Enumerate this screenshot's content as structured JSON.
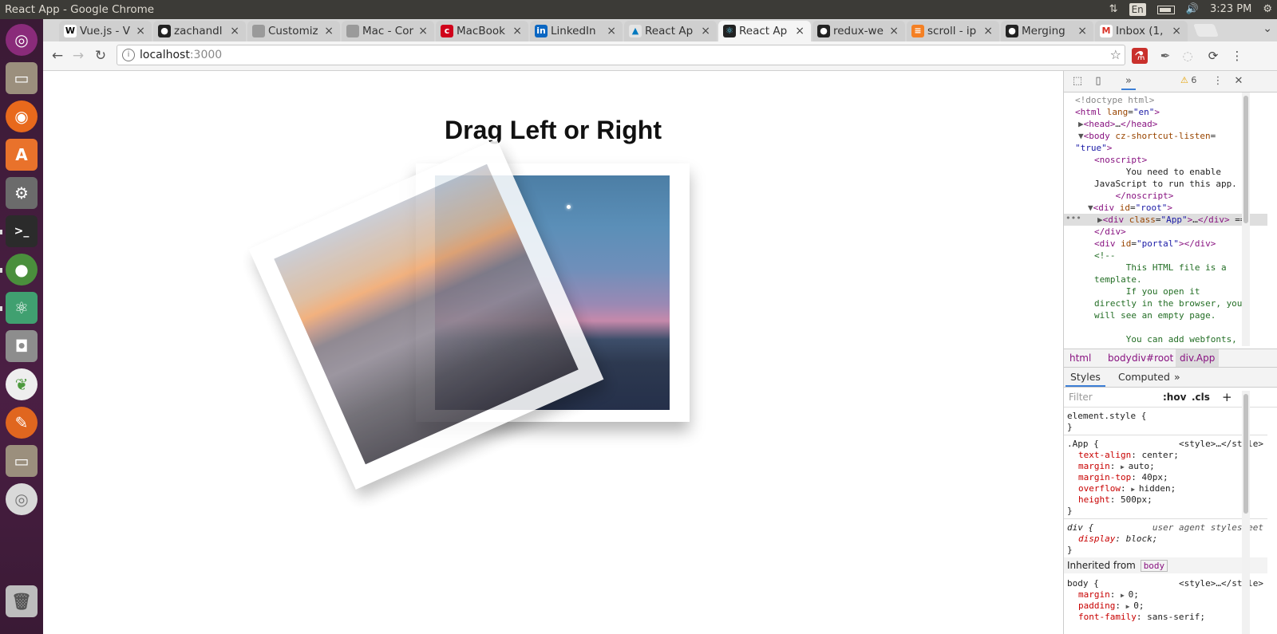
{
  "window": {
    "title": "React App - Google Chrome"
  },
  "tray": {
    "lang": "En",
    "time": "3:23 PM"
  },
  "tabs": [
    {
      "label": "Vue.js - V",
      "fav": "W",
      "favcolor": "#ffffff",
      "favtext": "#000000"
    },
    {
      "label": "zachandl",
      "fav": "●",
      "favcolor": "#222222",
      "favtext": "#ffffff"
    },
    {
      "label": "Customiz",
      "fav": "",
      "favcolor": "#9a9a9a",
      "favtext": "#ffffff"
    },
    {
      "label": "Mac - Cor",
      "fav": "",
      "favcolor": "#9a9a9a",
      "favtext": "#ffffff"
    },
    {
      "label": "MacBook",
      "fav": "c",
      "favcolor": "#d0021b",
      "favtext": "#ffffff"
    },
    {
      "label": "LinkedIn",
      "fav": "in",
      "favcolor": "#0a66c2",
      "favtext": "#ffffff"
    },
    {
      "label": "React Ap",
      "fav": "▲",
      "favcolor": "#e4e4e4",
      "favtext": "#0079bf"
    },
    {
      "label": "React Ap",
      "fav": "⚛",
      "favcolor": "#222222",
      "favtext": "#61dafb",
      "active": true
    },
    {
      "label": "redux-we",
      "fav": "●",
      "favcolor": "#222222",
      "favtext": "#ffffff"
    },
    {
      "label": "scroll - ip",
      "fav": "≡",
      "favcolor": "#f48024",
      "favtext": "#ffffff"
    },
    {
      "label": "Merging",
      "fav": "●",
      "favcolor": "#222222",
      "favtext": "#ffffff"
    },
    {
      "label": "Inbox (1,",
      "fav": "M",
      "favcolor": "#ffffff",
      "favtext": "#d93025"
    }
  ],
  "tab_close_glyph": "×",
  "omnibox": {
    "host": "localhost",
    "port": ":3000"
  },
  "app": {
    "title": "Drag Left or Right"
  },
  "devtools": {
    "warning_count": "6",
    "dom_lines": [
      {
        "html": "<span class='g'>&lt;!doctype html&gt;</span>",
        "indent": 14
      },
      {
        "html": "<span class='t'>&lt;html</span> <span class='a'>lang</span>=<span class='v'>\"en\"</span><span class='t'>&gt;</span>",
        "indent": 14
      },
      {
        "html": "<span class='tri'>▶</span><span class='t'>&lt;head&gt;</span>…<span class='t'>&lt;/head&gt;</span>",
        "indent": 18
      },
      {
        "html": "<span class='tri'>▼</span><span class='t'>&lt;body</span> <span class='a'>cz-shortcut-listen</span>=",
        "indent": 18
      },
      {
        "html": "<span class='v'>\"true\"</span><span class='t'>&gt;</span>",
        "indent": 14
      },
      {
        "html": "<span class='t'>&lt;noscript&gt;</span>",
        "indent": 38
      },
      {
        "html": "      You need to enable",
        "indent": 38
      },
      {
        "html": "JavaScript to run this app.",
        "indent": 38
      },
      {
        "html": "    <span class='t'>&lt;/noscript&gt;</span>",
        "indent": 38
      },
      {
        "html": "<span class='tri'>▼</span><span class='t'>&lt;div</span> <span class='a'>id</span>=<span class='v'>\"root\"</span><span class='t'>&gt;</span>",
        "indent": 30
      },
      {
        "html": "<span class='tri'>▶</span><span class='t'>&lt;div</span> <span class='a'>class</span>=<span class='v'>\"App\"</span><span class='t'>&gt;</span>…<span class='t'>&lt;/div&gt;</span> ==",
        "indent": 42,
        "sel": true
      },
      {
        "html": "<span class='t'>&lt;/div&gt;</span>",
        "indent": 38
      },
      {
        "html": "<span class='t'>&lt;div</span> <span class='a'>id</span>=<span class='v'>\"portal\"</span><span class='t'>&gt;&lt;/div&gt;</span>",
        "indent": 38
      },
      {
        "html": "<span class='c'>&lt;!--</span>",
        "indent": 38
      },
      {
        "html": "<span class='c'>      This HTML file is a</span>",
        "indent": 38
      },
      {
        "html": "<span class='c'>template.</span>",
        "indent": 38
      },
      {
        "html": "<span class='c'>      If you open it</span>",
        "indent": 38
      },
      {
        "html": "<span class='c'>directly in the browser, you</span>",
        "indent": 38
      },
      {
        "html": "<span class='c'>will see an empty page.</span>",
        "indent": 38
      },
      {
        "html": "",
        "indent": 38
      },
      {
        "html": "<span class='c'>      You can add webfonts,</span>",
        "indent": 38
      }
    ],
    "breadcrumbs": [
      "html",
      "body",
      "div#root",
      "div.App"
    ],
    "subtabs": [
      "Styles",
      "Computed",
      "»"
    ],
    "filter": {
      "placeholder": "Filter",
      "hov": ":hov",
      "cls": ".cls",
      "plus": "+"
    },
    "styles": {
      "element_style": "element.style {",
      "close": "}",
      "app_selector": ".App {",
      "app_source": "<style>…</style>",
      "app_props": [
        {
          "name": "text-align",
          "value": "center;",
          "arrow": ""
        },
        {
          "name": "margin",
          "value": "auto;",
          "arrow": "▶"
        },
        {
          "name": "margin-top",
          "value": "40px;",
          "arrow": ""
        },
        {
          "name": "overflow",
          "value": "hidden;",
          "arrow": "▶"
        },
        {
          "name": "height",
          "value": "500px;",
          "arrow": ""
        }
      ],
      "div_selector": "div {",
      "div_source": "user agent stylesheet",
      "div_prop": {
        "name": "display",
        "value": "block;"
      },
      "inherited_label": "Inherited from",
      "inherited_tag": "body",
      "body_selector": "body {",
      "body_source": "<style>…</style>",
      "body_props": [
        {
          "name": "margin",
          "value": "0;",
          "arrow": "▶"
        },
        {
          "name": "padding",
          "value": "0;",
          "arrow": "▶"
        },
        {
          "name": "font-family",
          "value": "sans-serif;",
          "arrow": ""
        }
      ]
    }
  }
}
